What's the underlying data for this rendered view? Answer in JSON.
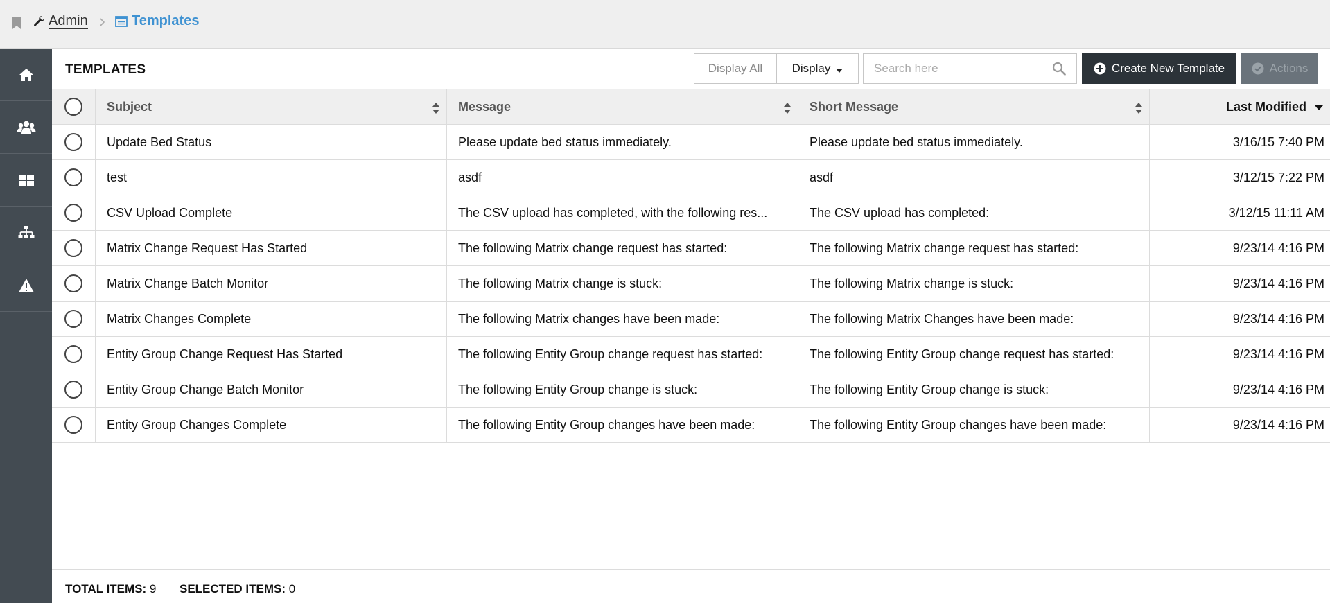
{
  "breadcrumb": {
    "admin_label": "Admin",
    "templates_label": "Templates"
  },
  "sidebar": {
    "items": [
      {
        "icon": "home-icon"
      },
      {
        "icon": "users-icon"
      },
      {
        "icon": "dashboard-icon"
      },
      {
        "icon": "hierarchy-icon"
      },
      {
        "icon": "warning-icon"
      }
    ]
  },
  "toolbar": {
    "title": "TEMPLATES",
    "display_all_label": "Display All",
    "display_label": "Display",
    "search_placeholder": "Search here",
    "create_label": "Create New Template",
    "actions_label": "Actions"
  },
  "table": {
    "columns": {
      "subject": "Subject",
      "message": "Message",
      "short_message": "Short Message",
      "last_modified": "Last Modified"
    },
    "rows": [
      {
        "subject": "Update Bed Status",
        "message": "Please update bed status immediately.",
        "short_message": "Please update bed status immediately.",
        "last_modified": "3/16/15 7:40 PM"
      },
      {
        "subject": "test",
        "message": "asdf",
        "short_message": "asdf",
        "last_modified": "3/12/15 7:22 PM"
      },
      {
        "subject": "CSV Upload Complete",
        "message": "The CSV upload has completed, with the following res...",
        "short_message": "The CSV upload has completed:",
        "last_modified": "3/12/15 11:11 AM"
      },
      {
        "subject": "Matrix Change Request Has Started",
        "message": "The following Matrix change request has started:",
        "short_message": "The following Matrix change request has started:",
        "last_modified": "9/23/14 4:16 PM"
      },
      {
        "subject": "Matrix Change Batch Monitor",
        "message": "The following Matrix change is stuck:",
        "short_message": "The following Matrix change is stuck:",
        "last_modified": "9/23/14 4:16 PM"
      },
      {
        "subject": "Matrix Changes Complete",
        "message": "The following Matrix changes have been made:",
        "short_message": "The following Matrix Changes have been made:",
        "last_modified": "9/23/14 4:16 PM"
      },
      {
        "subject": "Entity Group Change Request Has Started",
        "message": "The following Entity Group change request has started:",
        "short_message": "The following Entity Group change request has started:",
        "last_modified": "9/23/14 4:16 PM"
      },
      {
        "subject": "Entity Group Change Batch Monitor",
        "message": "The following Entity Group change is stuck:",
        "short_message": "The following Entity Group change is stuck:",
        "last_modified": "9/23/14 4:16 PM"
      },
      {
        "subject": "Entity Group Changes Complete",
        "message": "The following Entity Group changes have been made:",
        "short_message": "The following Entity Group changes have been made:",
        "last_modified": "9/23/14 4:16 PM"
      }
    ]
  },
  "footer": {
    "total_label": "TOTAL ITEMS:",
    "total_value": "9",
    "selected_label": "SELECTED ITEMS:",
    "selected_value": "0"
  },
  "colors": {
    "accent": "#3f92d2",
    "sidebar": "#434b52",
    "primary_button": "#2c3339"
  }
}
